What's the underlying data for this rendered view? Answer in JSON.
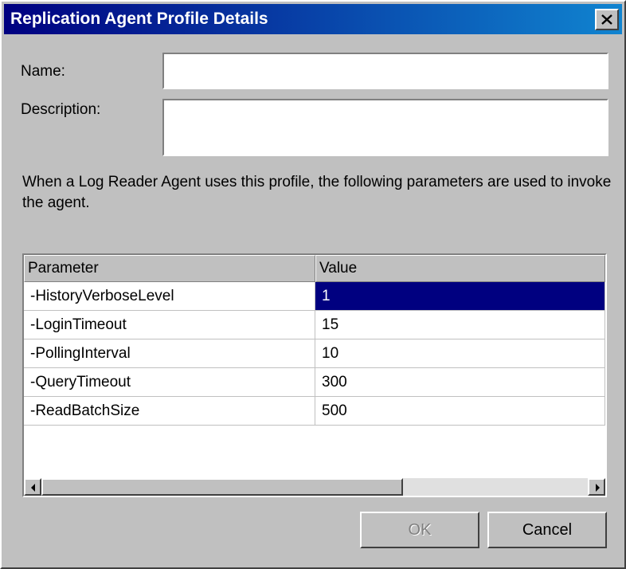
{
  "window": {
    "title": "Replication Agent Profile Details"
  },
  "form": {
    "name_label": "Name:",
    "name_value": "",
    "description_label": "Description:",
    "description_value": ""
  },
  "info_text": "When a Log Reader Agent uses this profile, the following parameters are used to invoke the agent.",
  "table": {
    "columns": [
      "Parameter",
      "Value"
    ],
    "rows": [
      {
        "parameter": "-HistoryVerboseLevel",
        "value": "1"
      },
      {
        "parameter": "-LoginTimeout",
        "value": "15"
      },
      {
        "parameter": "-PollingInterval",
        "value": "10"
      },
      {
        "parameter": "-QueryTimeout",
        "value": "300"
      },
      {
        "parameter": "-ReadBatchSize",
        "value": "500"
      }
    ],
    "selected_row": 0
  },
  "buttons": {
    "ok_label": "OK",
    "cancel_label": "Cancel"
  },
  "colors": {
    "titlebar_start": "#000080",
    "titlebar_end": "#1084d0",
    "selection": "#000080",
    "face": "#c0c0c0"
  },
  "icons": [
    "close-icon",
    "scroll-left-arrow-icon",
    "scroll-right-arrow-icon"
  ]
}
